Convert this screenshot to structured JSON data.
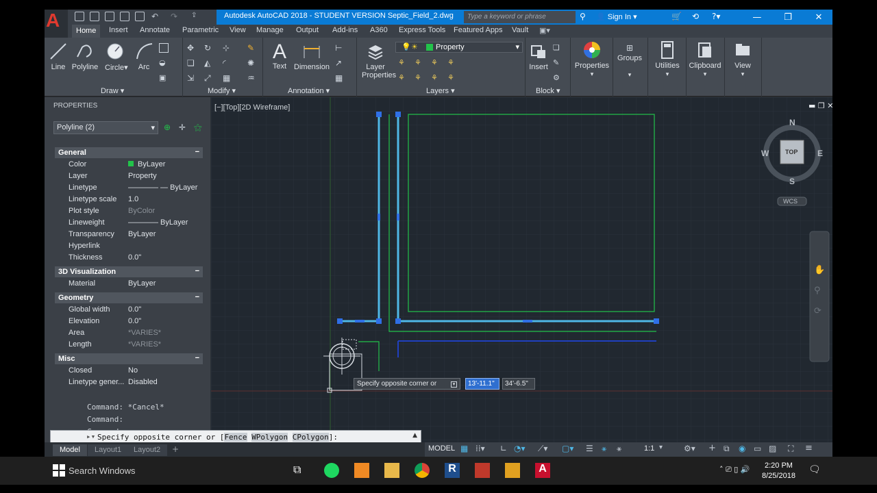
{
  "titlebar": {
    "app_logo": "A",
    "title": "Autodesk AutoCAD 2018 - STUDENT VERSION    Septic_Field_2.dwg",
    "search_placeholder": "Type a keyword or phrase",
    "sign_in": "Sign In",
    "minimize": "—",
    "restore": "❐",
    "close": "✕"
  },
  "tabs": [
    "Home",
    "Insert",
    "Annotate",
    "Parametric",
    "View",
    "Manage",
    "Output",
    "Add-ins",
    "A360",
    "Express Tools",
    "Featured Apps",
    "Vault"
  ],
  "ribbon": {
    "draw": {
      "line": "Line",
      "polyline": "Polyline",
      "circle": "Circle",
      "arc": "Arc",
      "title": "Draw ▾"
    },
    "modify_title": "Modify ▾",
    "annotation": {
      "text": "Text",
      "dimension": "Dimension",
      "title": "Annotation ▾"
    },
    "layers": {
      "layer_properties_1": "Layer",
      "layer_properties_2": "Properties",
      "current_layer": "Property",
      "title": "Layers ▾"
    },
    "block": {
      "insert": "Insert",
      "title": "Block ▾"
    },
    "properties": "Properties",
    "groups": "Groups",
    "utilities": "Utilities",
    "clipboard": "Clipboard",
    "view": "View"
  },
  "properties_palette": {
    "title": "PROPERTIES",
    "selection": "Polyline (2)",
    "sections": {
      "general": "General",
      "visualization": "3D Visualization",
      "geometry": "Geometry",
      "misc": "Misc"
    },
    "general_rows": [
      {
        "k": "Color",
        "v": "ByLayer"
      },
      {
        "k": "Layer",
        "v": "Property"
      },
      {
        "k": "Linetype",
        "v": "———— — ByLayer"
      },
      {
        "k": "Linetype scale",
        "v": "1.0"
      },
      {
        "k": "Plot style",
        "v": "ByColor"
      },
      {
        "k": "Lineweight",
        "v": "———— ByLayer"
      },
      {
        "k": "Transparency",
        "v": "ByLayer"
      },
      {
        "k": "Hyperlink",
        "v": ""
      },
      {
        "k": "Thickness",
        "v": "0.0\""
      }
    ],
    "visualization_rows": [
      {
        "k": "Material",
        "v": "ByLayer"
      }
    ],
    "geometry_rows": [
      {
        "k": "Global width",
        "v": "0.0\""
      },
      {
        "k": "Elevation",
        "v": "0.0\""
      },
      {
        "k": "Area",
        "v": "*VARIES*"
      },
      {
        "k": "Length",
        "v": "*VARIES*"
      }
    ],
    "misc_rows": [
      {
        "k": "Closed",
        "v": "No"
      },
      {
        "k": "Linetype gener...",
        "v": "Disabled"
      }
    ]
  },
  "command_history": [
    "Command: *Cancel*",
    "Command:",
    "Command:"
  ],
  "command_line": {
    "prompt_start": "Specify opposite corner or [",
    "kw1": "Fence",
    "kw2": "WPolygon",
    "kw3": "CPolygon",
    "prompt_end": "]:"
  },
  "viewport": {
    "label": "[−][Top][2D Wireframe]",
    "compass": {
      "n": "N",
      "s": "S",
      "e": "E",
      "w": "W",
      "top": "TOP",
      "wcs": "WCS"
    }
  },
  "dynamic_input": {
    "prompt": "Specify opposite corner or",
    "field1": "13'-11.1\"",
    "field2": "34'-6.5\""
  },
  "layout_tabs": [
    "Model",
    "Layout1",
    "Layout2"
  ],
  "status": {
    "model": "MODEL",
    "scale": "1:1"
  },
  "taskbar": {
    "search": "Search Windows",
    "time": "2:20 PM",
    "date": "8/25/2018"
  },
  "colors": {
    "accent": "#0a7bd5",
    "green_line": "#22c34a",
    "cyan_line": "#4fb7e6",
    "grip": "#2f6fe6"
  }
}
